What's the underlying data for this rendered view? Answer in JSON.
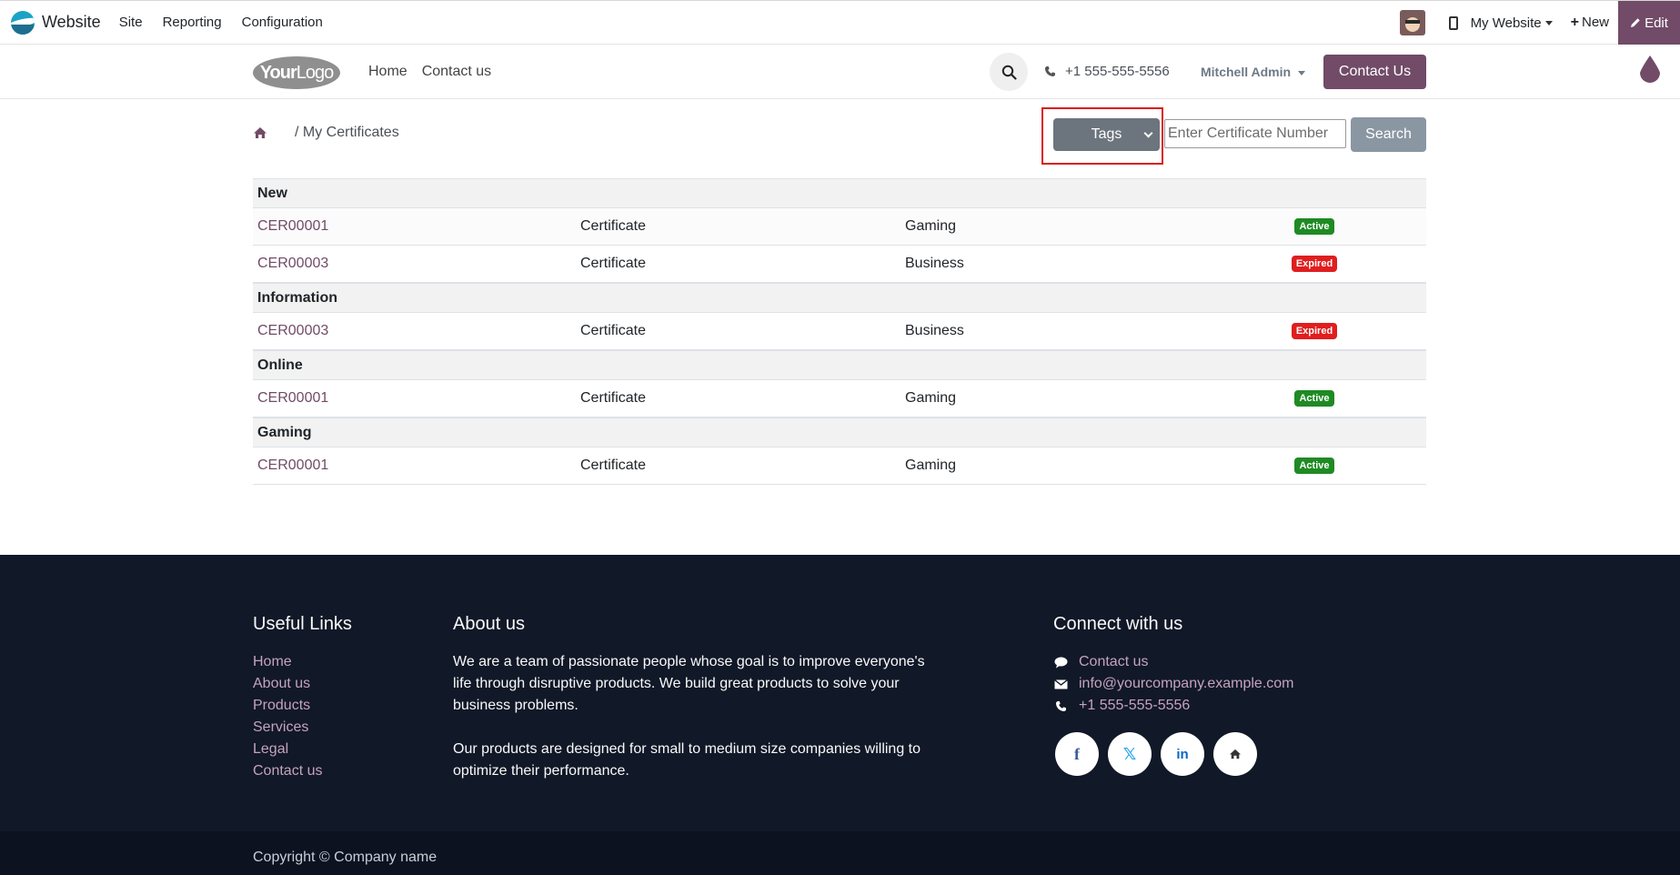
{
  "adminbar": {
    "app_name": "Website",
    "menu": [
      "Site",
      "Reporting",
      "Configuration"
    ],
    "website_selector": "My Website",
    "new_label": "New",
    "edit_label": "Edit"
  },
  "header": {
    "logo_text_bold": "Your",
    "logo_text_thin": "Logo",
    "nav": [
      "Home",
      "Contact us"
    ],
    "phone": "+1 555-555-5556",
    "user": "Mitchell Admin",
    "contact_button": "Contact Us"
  },
  "breadcrumb": {
    "current": "/ My Certificates"
  },
  "filter": {
    "tags_label": "Tags",
    "input_placeholder": "Enter Certificate Number",
    "input_value": "",
    "search_label": "Search"
  },
  "groups": [
    {
      "name": "New",
      "rows": [
        {
          "number": "CER00001",
          "type": "Certificate",
          "tag": "Gaming",
          "status": "Active"
        },
        {
          "number": "CER00003",
          "type": "Certificate",
          "tag": "Business",
          "status": "Expired"
        }
      ]
    },
    {
      "name": "Information",
      "rows": [
        {
          "number": "CER00003",
          "type": "Certificate",
          "tag": "Business",
          "status": "Expired"
        }
      ]
    },
    {
      "name": "Online",
      "rows": [
        {
          "number": "CER00001",
          "type": "Certificate",
          "tag": "Gaming",
          "status": "Active"
        }
      ]
    },
    {
      "name": "Gaming",
      "rows": [
        {
          "number": "CER00001",
          "type": "Certificate",
          "tag": "Gaming",
          "status": "Active"
        }
      ]
    }
  ],
  "footer": {
    "links_title": "Useful Links",
    "links": [
      "Home",
      "About us",
      "Products",
      "Services",
      "Legal",
      "Contact us"
    ],
    "about_title": "About us",
    "about_p1": "We are a team of passionate people whose goal is to improve everyone's life through disruptive products. We build great products to solve your business problems.",
    "about_p2": "Our products are designed for small to medium size companies willing to optimize their performance.",
    "connect_title": "Connect with us",
    "connect_contact": "Contact us",
    "connect_email": "info@yourcompany.example.com",
    "connect_phone": "+1 555-555-5556",
    "socials": [
      "facebook-icon",
      "x-icon",
      "linkedin-icon",
      "home-icon"
    ],
    "copyright": "Copyright © Company name"
  },
  "colors": {
    "brand": "#714b67",
    "footer_bg": "#111827",
    "active_badge": "#1f8a24",
    "expired_badge": "#e01e1e",
    "highlight": "#d91c1c"
  }
}
